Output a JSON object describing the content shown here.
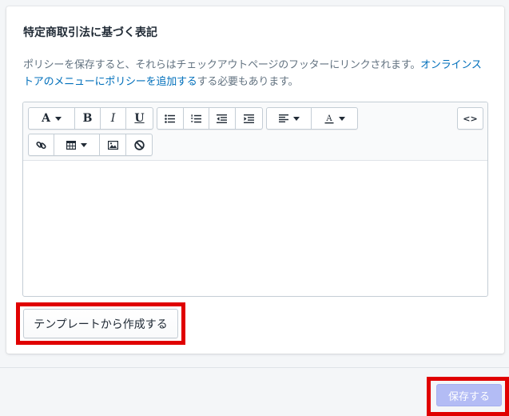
{
  "section": {
    "title": "特定商取引法に基づく表記",
    "description_prefix": "ポリシーを保存すると、それらはチェックアウトページのフッターにリンクされます。",
    "description_link": "オンラインストアのメニューにポリシーを追加する",
    "description_suffix": "する必要もあります。"
  },
  "toolbar": {
    "font_label": "A",
    "bold_label": "B",
    "italic_label": "I",
    "underline_label": "U",
    "html_label": "<>"
  },
  "editor": {
    "content": ""
  },
  "actions": {
    "template_button": "テンプレートから作成する",
    "save_button": "保存する"
  },
  "colors": {
    "link": "#006fbb",
    "highlight": "#e00000",
    "save_disabled": "#b3bcf5"
  }
}
